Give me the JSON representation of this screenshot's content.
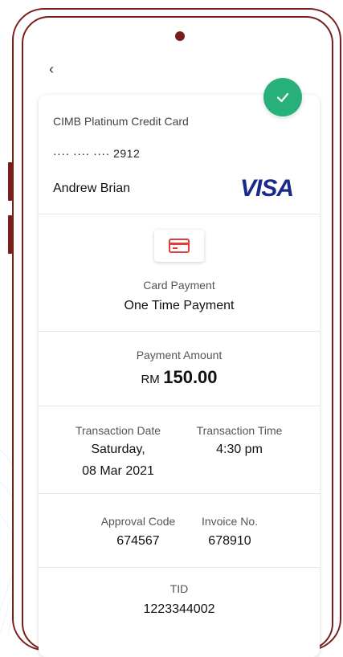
{
  "nav": {
    "back_glyph": "‹"
  },
  "card": {
    "name": "CIMB Platinum Credit Card",
    "number": "···· ···· ···· 2912",
    "holder": "Andrew Brian",
    "brand": "VISA"
  },
  "payment": {
    "type_label": "Card Payment",
    "type_value": "One Time Payment"
  },
  "amount": {
    "label": "Payment Amount",
    "currency": "RM",
    "value": "150.00"
  },
  "transaction": {
    "date_label": "Transaction Date",
    "date_line1": "Saturday,",
    "date_line2": "08 Mar 2021",
    "time_label": "Transaction Time",
    "time_value": "4:30 pm"
  },
  "codes": {
    "approval_label": "Approval Code",
    "approval_value": "674567",
    "invoice_label": "Invoice No.",
    "invoice_value": "678910"
  },
  "tid": {
    "label": "TID",
    "value": "1223344002"
  },
  "colors": {
    "frame": "#7a1d1d",
    "success": "#27b07a",
    "card_icon": "#e23b3b",
    "visa": "#1a2a8a"
  },
  "icons": [
    "chevron-left-icon",
    "check-icon",
    "credit-card-icon"
  ]
}
